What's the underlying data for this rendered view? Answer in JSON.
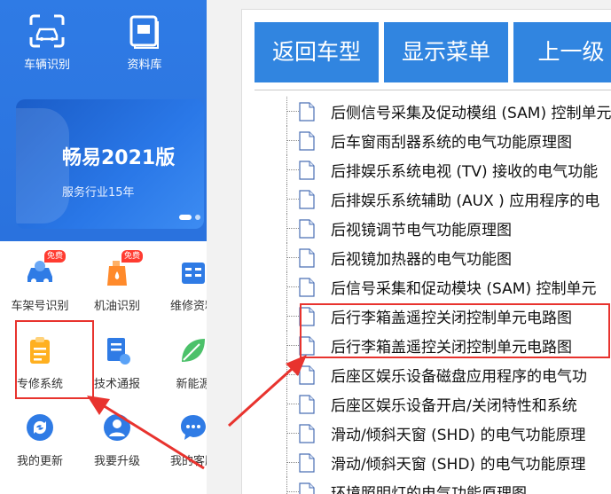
{
  "phone": {
    "top_items": [
      {
        "label": "车辆识别",
        "icon": "car-scan-icon"
      },
      {
        "label": "资料库",
        "icon": "library-icon"
      }
    ],
    "banner": {
      "title": "畅易2021版",
      "subtitle": "服务行业15年"
    },
    "grid": [
      {
        "label": "车架号识别",
        "icon": "vin-car-icon",
        "badge": "免费"
      },
      {
        "label": "机油识别",
        "icon": "oil-icon",
        "badge": "免费"
      },
      {
        "label": "维修资料",
        "icon": "repair-docs-icon",
        "badge": ""
      },
      {
        "label": "专修系统",
        "icon": "clipboard-icon",
        "badge": ""
      },
      {
        "label": "技术通报",
        "icon": "bulletin-icon",
        "badge": ""
      },
      {
        "label": "新能源",
        "icon": "leaf-icon",
        "badge": ""
      },
      {
        "label": "我的更新",
        "icon": "refresh-icon",
        "badge": ""
      },
      {
        "label": "我要升级",
        "icon": "user-upgrade-icon",
        "badge": ""
      },
      {
        "label": "我的客服",
        "icon": "chat-icon",
        "badge": ""
      }
    ]
  },
  "toolbar": {
    "back_label": "返回车型",
    "menu_label": "显示菜单",
    "up_label": "上一级"
  },
  "tree": [
    "后侧信号采集及促动模组 (SAM) 控制单元",
    "后车窗雨刮器系统的电气功能原理图",
    "后排娱乐系统电视 (TV) 接收的电气功能",
    "后排娱乐系统辅助 (AUX ) 应用程序的电",
    "后视镜调节电气功能原理图",
    "后视镜加热器的电气功能图",
    "后信号采集和促动模块 (SAM) 控制单元",
    "后行李箱盖遥控关闭控制单元电路图",
    "后行李箱盖遥控关闭控制单元电路图",
    "后座区娱乐设备磁盘应用程序的电气功",
    "后座区娱乐设备开启/关闭特性和系统",
    "滑动/倾斜天窗 (SHD) 的电气功能原理",
    "滑动/倾斜天窗 (SHD) 的电气功能原理",
    "环境照明灯的电气功能原理图"
  ],
  "colors": {
    "brand_blue": "#2f7be5",
    "button_blue": "#3185e0",
    "highlight_red": "#e8332e",
    "badge_red": "#ff3b30"
  }
}
